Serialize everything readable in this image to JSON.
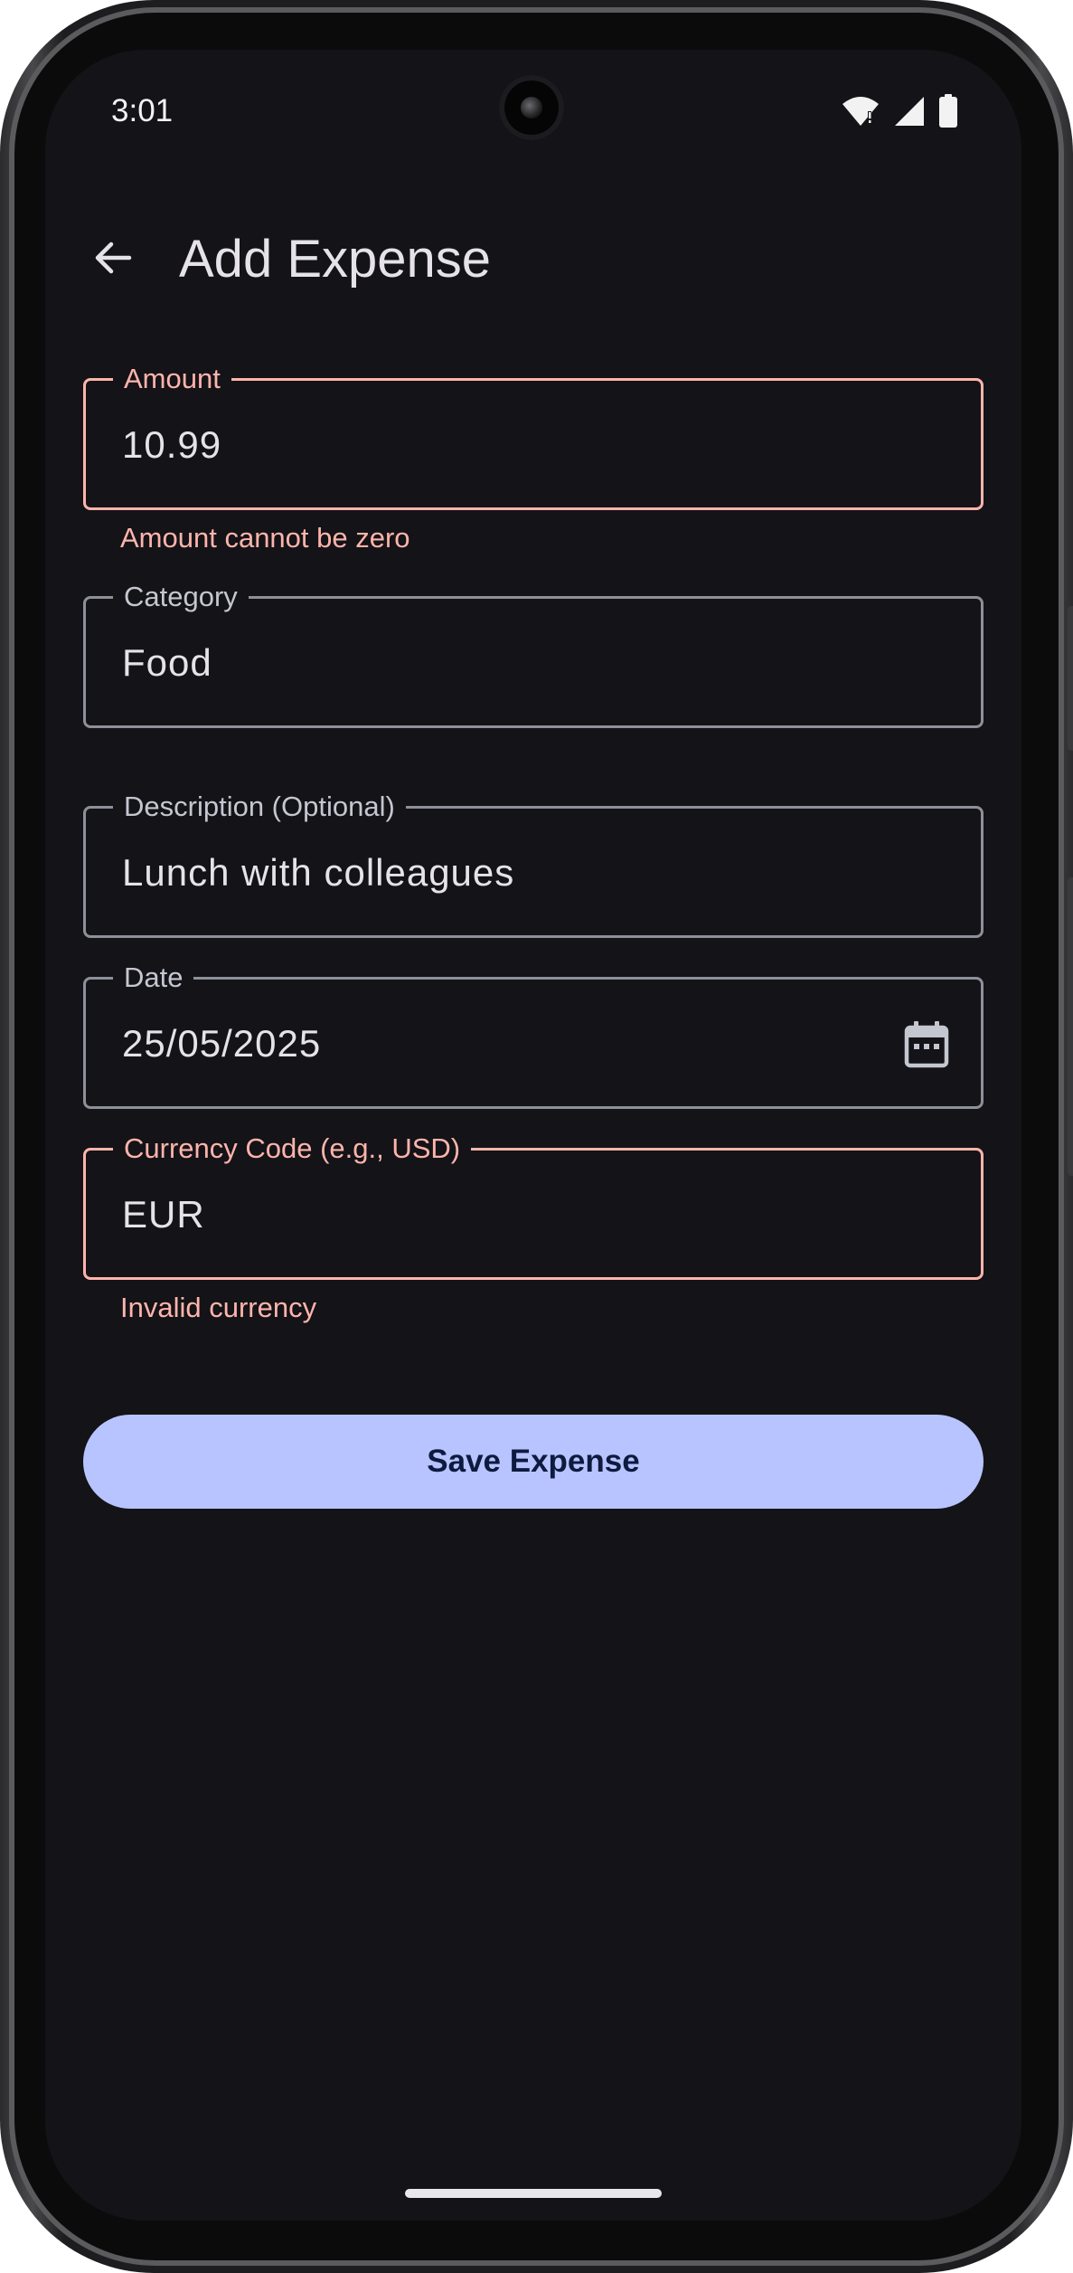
{
  "status_bar": {
    "time": "3:01",
    "icons": [
      "wifi-icon",
      "cellular-icon",
      "battery-icon"
    ]
  },
  "app_bar": {
    "back_icon": "arrow-back-icon",
    "title": "Add Expense"
  },
  "form": {
    "amount": {
      "label": "Amount",
      "value": "10.99",
      "error": "Amount cannot be zero"
    },
    "category": {
      "label": "Category",
      "value": "Food"
    },
    "description": {
      "label": "Description (Optional)",
      "value": "Lunch with colleagues"
    },
    "date": {
      "label": "Date",
      "value": "25/05/2025",
      "icon": "calendar-icon"
    },
    "currency": {
      "label": "Currency Code (e.g., USD)",
      "value": "EUR",
      "error": "Invalid currency"
    }
  },
  "actions": {
    "save_label": "Save Expense"
  },
  "colors": {
    "background": "#131318",
    "error": "#ffb4ab",
    "outline": "#8e9099",
    "primary_container": "#b7c4ff",
    "on_surface": "#e5e2e9"
  }
}
